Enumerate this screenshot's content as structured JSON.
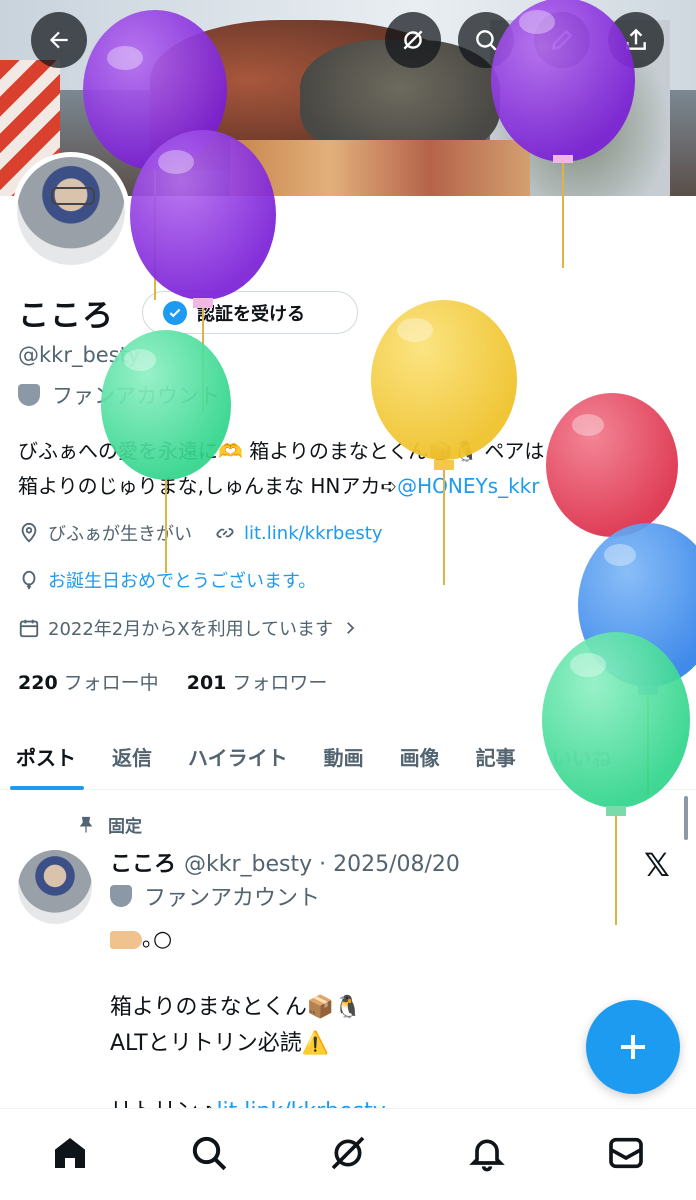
{
  "profile": {
    "name": "こころ",
    "verify_label": "認証を受ける",
    "handle": "@kkr_besty",
    "fan_label": "ファンアカウント",
    "bio_line1": "びふぁへの愛を永遠に🫶 箱よりのまなとくん📦🐧 ペアは",
    "bio_line2_text": "箱よりのじゅりまな,しゅんまな HNアカ➪",
    "bio_mention": "@HONEYs_kkr",
    "location": "びふぁが生きがい",
    "website": "lit.link/kkrbesty",
    "birthday": "お誕生日おめでとうございます。",
    "joined": "2022年2月からXを利用しています",
    "following_count": "220",
    "following_label": "フォロー中",
    "followers_count": "201",
    "followers_label": "フォロワー"
  },
  "tabs": [
    "ポスト",
    "返信",
    "ハイライト",
    "動画",
    "画像",
    "記事",
    "いいね"
  ],
  "active_tab": "ポスト",
  "post": {
    "pinned_label": "固定",
    "author": "こころ",
    "meta": "@kkr_besty · 2025/08/20",
    "fan_label": "ファンアカウント",
    "line1": "｡○",
    "line2": "箱よりのまなとくん📦🐧",
    "line3": "ALTとリトリン必読⚠️",
    "line4_prefix": "リトリン➪",
    "line4_link": "lit.link/kkrbesty"
  },
  "icons": {
    "back": "arrow-left-icon",
    "grok": "grok-icon",
    "search": "search-icon",
    "edit": "pencil-icon",
    "share": "share-icon",
    "pin": "pin-icon",
    "x": "x-logo-icon",
    "compose": "plus-icon",
    "home": "home-icon",
    "explore": "search-icon",
    "grok_nav": "grok-icon",
    "notifications": "bell-icon",
    "messages": "mail-icon"
  },
  "colors": {
    "accent": "#1d9bf0",
    "text": "#0f1419",
    "muted": "#536471",
    "balloon_purple": "#8a2be2",
    "balloon_green": "#3ddc97",
    "balloon_yellow": "#f5cc3a",
    "balloon_red": "#e8445a",
    "balloon_blue": "#3b8ff0"
  }
}
